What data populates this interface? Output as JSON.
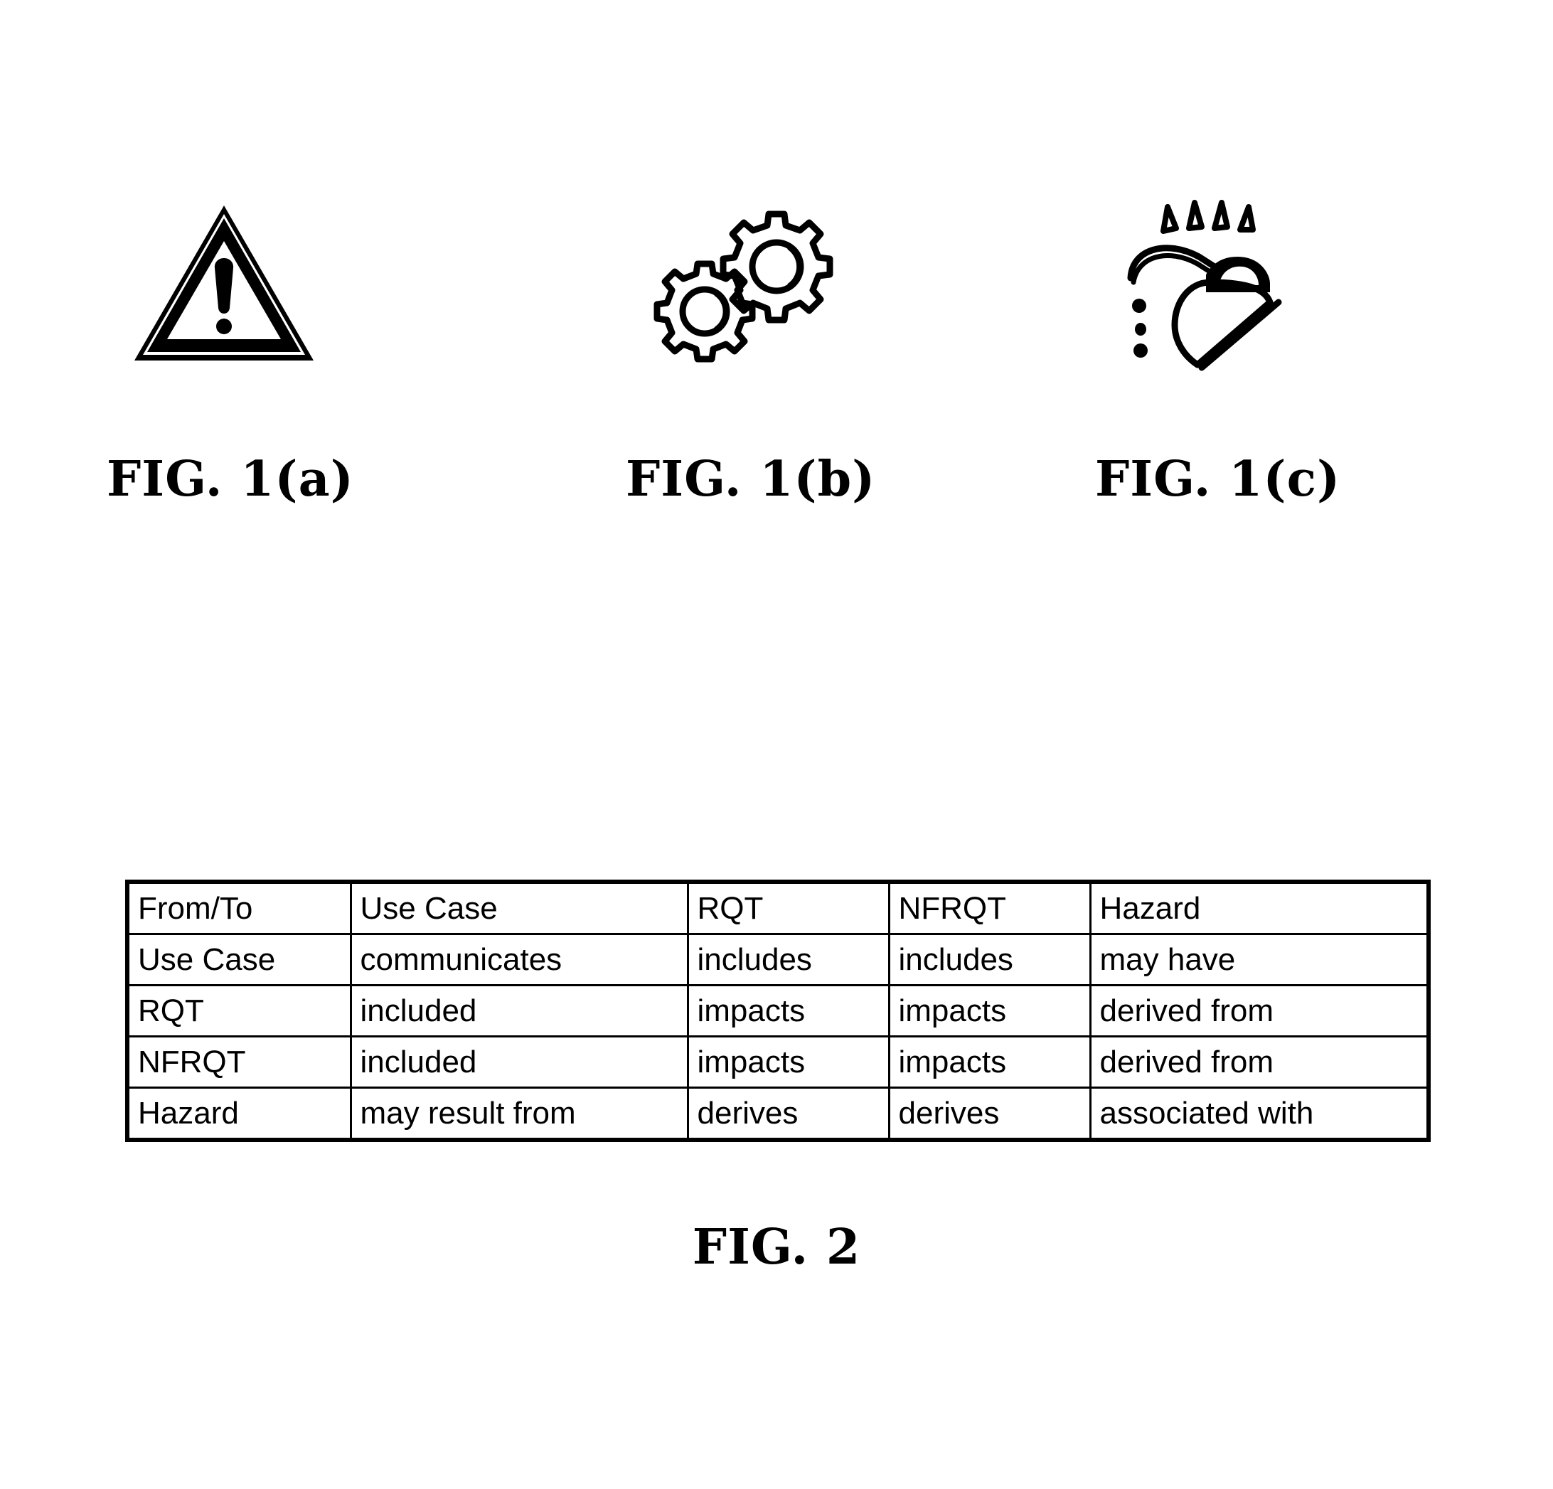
{
  "page": {
    "background_color": "#ffffff",
    "ink_color": "#000000"
  },
  "figures": [
    {
      "id": "fig-1a",
      "caption": "FIG. 1(a)",
      "icon": "warning-triangle-icon",
      "icon_description": "Black warning triangle outline with exclamation mark"
    },
    {
      "id": "fig-1b",
      "caption": "FIG. 1(b)",
      "icon": "gears-icon",
      "icon_description": "Two interlocking outlined gears"
    },
    {
      "id": "fig-1c",
      "caption": "FIG. 1(c)",
      "icon": "shower-head-icon",
      "icon_description": "Shower head with spray marks and droplets"
    }
  ],
  "fig2": {
    "caption": "FIG. 2",
    "table": {
      "header": [
        "From/To",
        "Use Case",
        "RQT",
        "NFRQT",
        "Hazard"
      ],
      "rows": [
        {
          "label": "Use Case",
          "cells": [
            "communicates",
            "includes",
            "includes",
            "may have"
          ]
        },
        {
          "label": "RQT",
          "cells": [
            "included",
            "impacts",
            "impacts",
            "derived from"
          ]
        },
        {
          "label": "NFRQT",
          "cells": [
            "included",
            "impacts",
            "impacts",
            "derived from"
          ]
        },
        {
          "label": "Hazard",
          "cells": [
            "may result from",
            "derives",
            "derives",
            "associated with"
          ]
        }
      ]
    }
  }
}
